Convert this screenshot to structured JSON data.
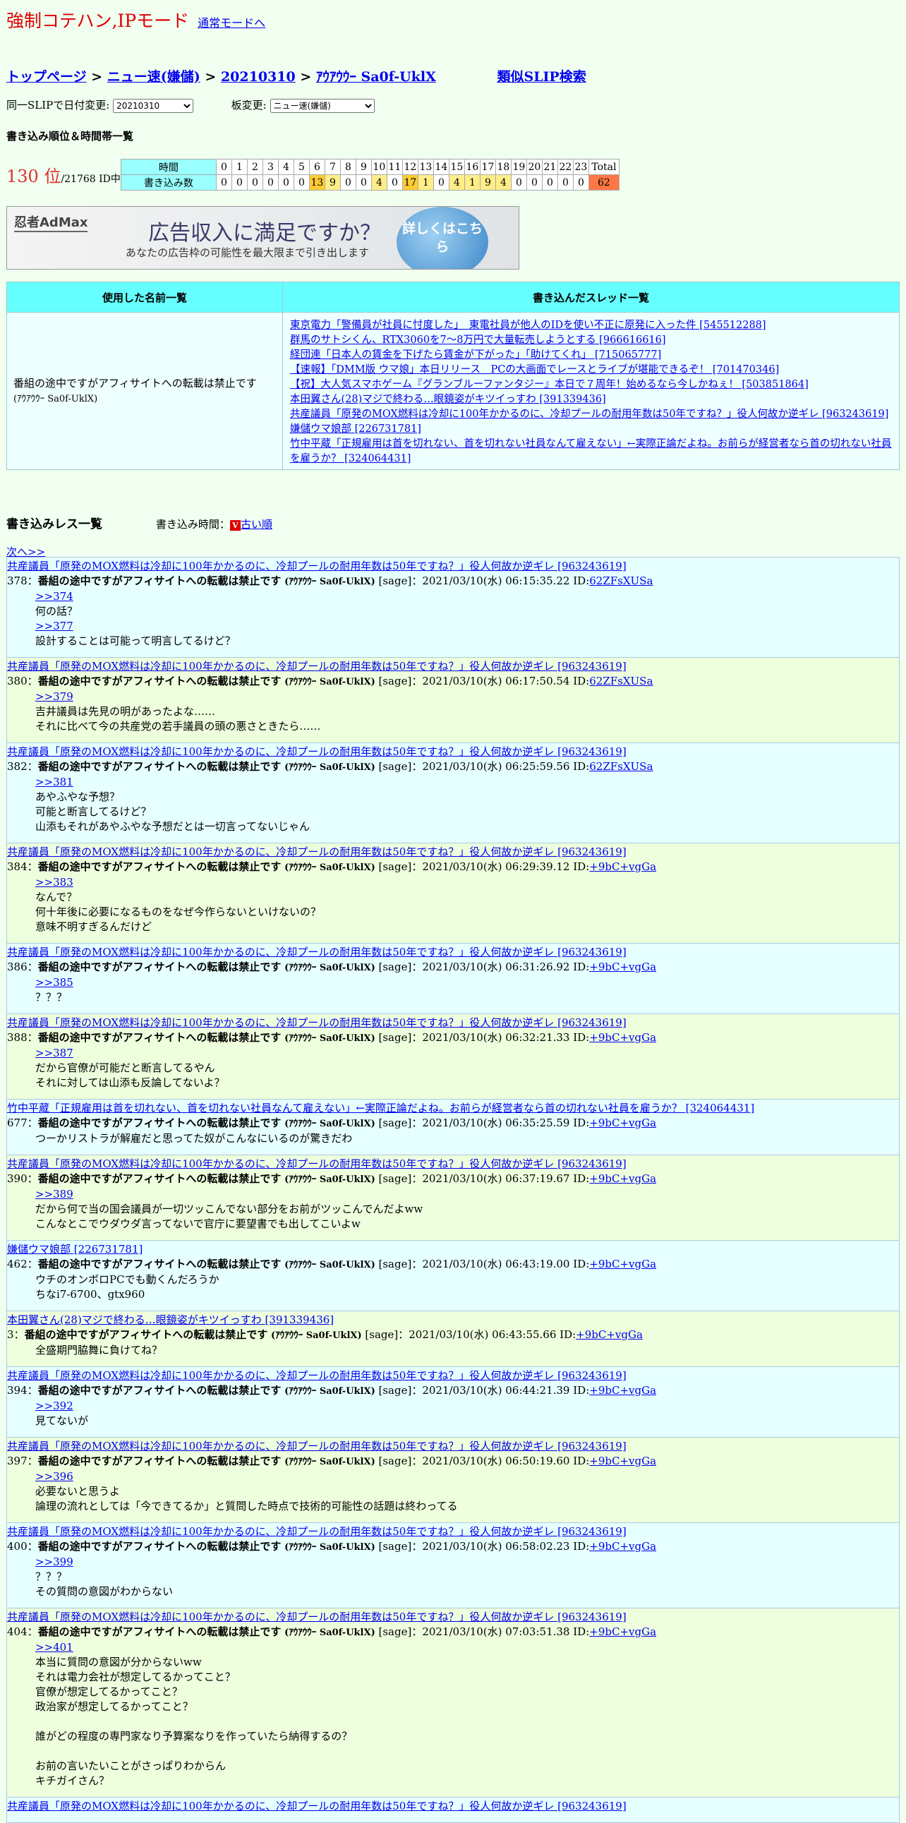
{
  "header": {
    "title": "強制コテハン,IPモード",
    "normal_mode_link": "通常モードへ"
  },
  "breadcrumb": {
    "top": "トップページ",
    "sep": ">",
    "board": "ニュー速(嫌儲)",
    "date": "20210310",
    "user": "ｱｳｱｳｳｰ Sa0f-UklX",
    "similar": "類似SLIP検索"
  },
  "controls": {
    "date_label": "同一SLIPで日付変更:",
    "date_value": "20210310",
    "board_label": "板変更:",
    "board_value": "ニュー速(嫌儲)"
  },
  "ranking": {
    "heading": "書き込み順位＆時間帯一覧",
    "rank": "130 位",
    "total_ids": "/21768 ID中",
    "row_time_label": "時間",
    "row_count_label": "書き込み数",
    "total_label": "Total",
    "hours": [
      "0",
      "1",
      "2",
      "3",
      "4",
      "5",
      "6",
      "7",
      "8",
      "9",
      "10",
      "11",
      "12",
      "13",
      "14",
      "15",
      "16",
      "17",
      "18",
      "19",
      "20",
      "21",
      "22",
      "23"
    ],
    "counts": [
      "0",
      "0",
      "0",
      "0",
      "0",
      "0",
      "13",
      "9",
      "0",
      "0",
      "4",
      "0",
      "17",
      "1",
      "0",
      "4",
      "1",
      "9",
      "4",
      "0",
      "0",
      "0",
      "0",
      "0"
    ],
    "total": "62"
  },
  "ad": {
    "brand": "忍者AdMax",
    "headline": "広告収入に満足ですか？",
    "sub": "あなたの広告枠の可能性を最大限まで引き出します",
    "button": "詳しくはこちら"
  },
  "names_table": {
    "col1": "使用した名前一覧",
    "col2": "書き込んだスレッド一覧",
    "name": "番組の途中ですがアフィサイトへの転載は禁止です",
    "trip": "(ｱｳｱｳｳｰ Sa0f-UklX)",
    "threads": [
      "東京電力「警備員が社員に忖度した」　東電社員が他人のIDを使い不正に原発に入った件 [545512288]",
      "群馬のサトシくん、RTX3060を7～8万円で大量転売しようとする [966616616]",
      "経団連「日本人の賃金を下げたら賃金が下がった」「助けてくれ」 [715065777]",
      "【速報】「DMM版 ウマ娘」本日リリース　PCの大画面でレースとライブが堪能できるぞ！ [701470346]",
      "【祝】大人気スマホゲーム『グランブルーファンタジー』本日で７周年！始めるなら今しかねぇ！ [503851864]",
      "本田翼さん(28)マジで終わる…眼鏡姿がキツイっすわ [391339436]",
      "共産議員「原発のMOX燃料は冷却に100年かかるのに、冷却プールの耐用年数は50年ですね？」役人何故か逆ギレ [963243619]",
      "嫌儲ウマ娘部 [226731781]",
      "竹中平蔵「正規雇用は首を切れない、首を切れない社員なんて雇えない」←実際正論だよね。お前らが経営者なら首の切れない社員を雇うか？ [324064431]"
    ]
  },
  "responses": {
    "heading": "書き込みレス一覧",
    "time_label": "書き込み時間：",
    "order_icon": "V",
    "order_link": "古い順",
    "next": "次へ>>"
  },
  "posts": [
    {
      "thread": "共産議員「原発のMOX燃料は冷却に100年かかるのに、冷却プールの耐用年数は50年ですね？」役人何故か逆ギレ [963243619]",
      "num": "378",
      "sage": "[sage]：2021/03/10(水) 06:15:35.22 ID:",
      "id": "62ZFsXUSa",
      "lines": [
        ">>374",
        "何の話？",
        ">>377",
        "設計することは可能って明言してるけど？"
      ],
      "links": [
        0,
        2
      ]
    },
    {
      "thread": "共産議員「原発のMOX燃料は冷却に100年かかるのに、冷却プールの耐用年数は50年ですね？」役人何故か逆ギレ [963243619]",
      "num": "380",
      "sage": "[sage]：2021/03/10(水) 06:17:50.54 ID:",
      "id": "62ZFsXUSa",
      "lines": [
        ">>379",
        "吉井議員は先見の明があったよな……",
        "それに比べて今の共産党の若手議員の頭の悪さときたら……"
      ],
      "links": [
        0
      ]
    },
    {
      "thread": "共産議員「原発のMOX燃料は冷却に100年かかるのに、冷却プールの耐用年数は50年ですね？」役人何故か逆ギレ [963243619]",
      "num": "382",
      "sage": "[sage]：2021/03/10(水) 06:25:59.56 ID:",
      "id": "62ZFsXUSa",
      "lines": [
        ">>381",
        "あやふやな予想？",
        "可能と断言してるけど？",
        "山添もそれがあやふやな予想だとは一切言ってないじゃん"
      ],
      "links": [
        0
      ]
    },
    {
      "thread": "共産議員「原発のMOX燃料は冷却に100年かかるのに、冷却プールの耐用年数は50年ですね？」役人何故か逆ギレ [963243619]",
      "num": "384",
      "sage": "[sage]：2021/03/10(水) 06:29:39.12 ID:",
      "id": "+9bC+vgGa",
      "lines": [
        ">>383",
        "なんで？",
        "何十年後に必要になるものをなぜ今作らないといけないの？",
        "意味不明すぎるんだけど"
      ],
      "links": [
        0
      ]
    },
    {
      "thread": "共産議員「原発のMOX燃料は冷却に100年かかるのに、冷却プールの耐用年数は50年ですね？」役人何故か逆ギレ [963243619]",
      "num": "386",
      "sage": "[sage]：2021/03/10(水) 06:31:26.92 ID:",
      "id": "+9bC+vgGa",
      "lines": [
        ">>385",
        "？？？"
      ],
      "links": [
        0
      ]
    },
    {
      "thread": "共産議員「原発のMOX燃料は冷却に100年かかるのに、冷却プールの耐用年数は50年ですね？」役人何故か逆ギレ [963243619]",
      "num": "388",
      "sage": "[sage]：2021/03/10(水) 06:32:21.33 ID:",
      "id": "+9bC+vgGa",
      "lines": [
        ">>387",
        "だから官僚が可能だと断言してるやん",
        "それに対しては山添も反論してないよ？"
      ],
      "links": [
        0
      ]
    },
    {
      "thread": "竹中平蔵「正規雇用は首を切れない、首を切れない社員なんて雇えない」←実際正論だよね。お前らが経営者なら首の切れない社員を雇うか？ [324064431]",
      "num": "677",
      "sage": "[sage]：2021/03/10(水) 06:35:25.59 ID:",
      "id": "+9bC+vgGa",
      "lines": [
        "つーかリストラが解雇だと思ってた奴がこんなにいるのが驚きだわ"
      ],
      "links": []
    },
    {
      "thread": "共産議員「原発のMOX燃料は冷却に100年かかるのに、冷却プールの耐用年数は50年ですね？」役人何故か逆ギレ [963243619]",
      "num": "390",
      "sage": "[sage]：2021/03/10(水) 06:37:19.67 ID:",
      "id": "+9bC+vgGa",
      "lines": [
        ">>389",
        "だから何で当の国会議員が一切ツッこんでない部分をお前がツッこんでんだよww",
        "こんなとこでウダウダ言ってないで官庁に要望書でも出してこいよw"
      ],
      "links": [
        0
      ]
    },
    {
      "thread": "嫌儲ウマ娘部 [226731781]",
      "num": "462",
      "sage": "[sage]：2021/03/10(水) 06:43:19.00 ID:",
      "id": "+9bC+vgGa",
      "lines": [
        "ウチのオンボロPCでも動くんだろうか",
        "ちなi7-6700、gtx960"
      ],
      "links": []
    },
    {
      "thread": "本田翼さん(28)マジで終わる…眼鏡姿がキツイっすわ [391339436]",
      "num": "3",
      "sage": "[sage]：2021/03/10(水) 06:43:55.66 ID:",
      "id": "+9bC+vgGa",
      "lines": [
        "全盛期門脇舞に負けてね？"
      ],
      "links": []
    },
    {
      "thread": "共産議員「原発のMOX燃料は冷却に100年かかるのに、冷却プールの耐用年数は50年ですね？」役人何故か逆ギレ [963243619]",
      "num": "394",
      "sage": "[sage]：2021/03/10(水) 06:44:21.39 ID:",
      "id": "+9bC+vgGa",
      "lines": [
        ">>392",
        "見てないが"
      ],
      "links": [
        0
      ]
    },
    {
      "thread": "共産議員「原発のMOX燃料は冷却に100年かかるのに、冷却プールの耐用年数は50年ですね？」役人何故か逆ギレ [963243619]",
      "num": "397",
      "sage": "[sage]：2021/03/10(水) 06:50:19.60 ID:",
      "id": "+9bC+vgGa",
      "lines": [
        ">>396",
        "必要ないと思うよ",
        "論理の流れとしては「今できてるか」と質問した時点で技術的可能性の話題は終わってる"
      ],
      "links": [
        0
      ]
    },
    {
      "thread": "共産議員「原発のMOX燃料は冷却に100年かかるのに、冷却プールの耐用年数は50年ですね？」役人何故か逆ギレ [963243619]",
      "num": "400",
      "sage": "[sage]：2021/03/10(水) 06:58:02.23 ID:",
      "id": "+9bC+vgGa",
      "lines": [
        ">>399",
        "？？？",
        "その質問の意図がわからない"
      ],
      "links": [
        0
      ]
    },
    {
      "thread": "共産議員「原発のMOX燃料は冷却に100年かかるのに、冷却プールの耐用年数は50年ですね？」役人何故か逆ギレ [963243619]",
      "num": "404",
      "sage": "[sage]：2021/03/10(水) 07:03:51.38 ID:",
      "id": "+9bC+vgGa",
      "lines": [
        ">>401",
        "本当に質問の意図が分からないww",
        "それは電力会社が想定してるかってこと？",
        "官僚が想定してるかってこと？",
        "政治家が想定してるかってこと？",
        "",
        "誰がどの程度の専門家なり予算案なりを作っていたら納得するの？",
        "",
        "お前の言いたいことがさっぱりわからん",
        "キチガイさん？"
      ],
      "links": [
        0
      ]
    },
    {
      "thread": "共産議員「原発のMOX燃料は冷却に100年かかるのに、冷却プールの耐用年数は50年ですね？」役人何故か逆ギレ [963243619]",
      "num": "",
      "sage": "",
      "id": "",
      "lines": [],
      "links": []
    }
  ],
  "post_common": {
    "sep": "：",
    "name": "番組の途中ですがアフィサイトへの転載は禁止です",
    "trip": "(ｱｳｱｳｳｰ Sa0f-UklX)"
  }
}
